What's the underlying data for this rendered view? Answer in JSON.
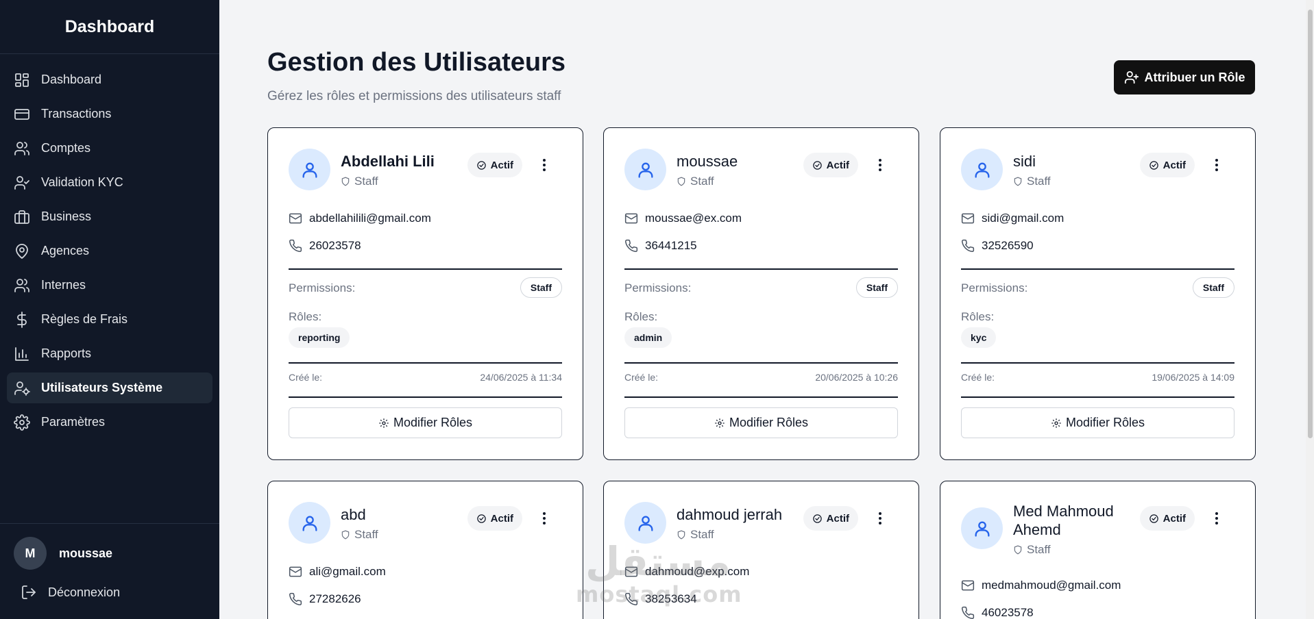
{
  "sidebar": {
    "title": "Dashboard",
    "items": [
      {
        "label": "Dashboard",
        "icon": "layout-dashboard-icon"
      },
      {
        "label": "Transactions",
        "icon": "credit-card-icon"
      },
      {
        "label": "Comptes",
        "icon": "users-icon"
      },
      {
        "label": "Validation KYC",
        "icon": "user-check-icon"
      },
      {
        "label": "Business",
        "icon": "briefcase-icon"
      },
      {
        "label": "Agences",
        "icon": "map-pin-icon"
      },
      {
        "label": "Internes",
        "icon": "users-icon"
      },
      {
        "label": "Règles de Frais",
        "icon": "dollar-sign-icon"
      },
      {
        "label": "Rapports",
        "icon": "bar-chart-icon"
      },
      {
        "label": "Utilisateurs Système",
        "icon": "user-cog-icon",
        "active": true
      },
      {
        "label": "Paramètres",
        "icon": "settings-icon"
      }
    ],
    "user": {
      "initial": "M",
      "name": "moussae"
    },
    "logout_label": "Déconnexion"
  },
  "header": {
    "title": "Gestion des Utilisateurs",
    "subtitle": "Gérez les rôles et permissions des utilisateurs staff",
    "assign_button": "Attribuer un Rôle"
  },
  "labels": {
    "status": "Actif",
    "type": "Staff",
    "permissions": "Permissions:",
    "roles": "Rôles:",
    "created": "Créé le:",
    "edit_roles": "Modifier Rôles"
  },
  "users": [
    {
      "name": "Abdellahi Lili",
      "email": "abdellahilili@gmail.com",
      "phone": "26023578",
      "permission": "Staff",
      "role": "reporting",
      "created": "24/06/2025 à 11:34"
    },
    {
      "name": "moussae",
      "email": "moussae@ex.com",
      "phone": "36441215",
      "permission": "Staff",
      "role": "admin",
      "created": "20/06/2025 à 10:26"
    },
    {
      "name": "sidi",
      "email": "sidi@gmail.com",
      "phone": "32526590",
      "permission": "Staff",
      "role": "kyc",
      "created": "19/06/2025 à 14:09"
    },
    {
      "name": "abd",
      "email": "ali@gmail.com",
      "phone": "27282626"
    },
    {
      "name": "dahmoud jerrah",
      "email": "dahmoud@exp.com",
      "phone": "38253634"
    },
    {
      "name": "Med Mahmoud Ahemd",
      "email": "medmahmoud@gmail.com",
      "phone": "46023578"
    }
  ],
  "watermark": {
    "arabic": "مستقل",
    "latin": "mostaql.com"
  },
  "colors": {
    "sidebar_bg": "#111827",
    "page_bg": "#f3f4f6",
    "avatar_bg": "#dbeafe",
    "avatar_icon": "#2563eb",
    "primary_button": "#111111"
  }
}
